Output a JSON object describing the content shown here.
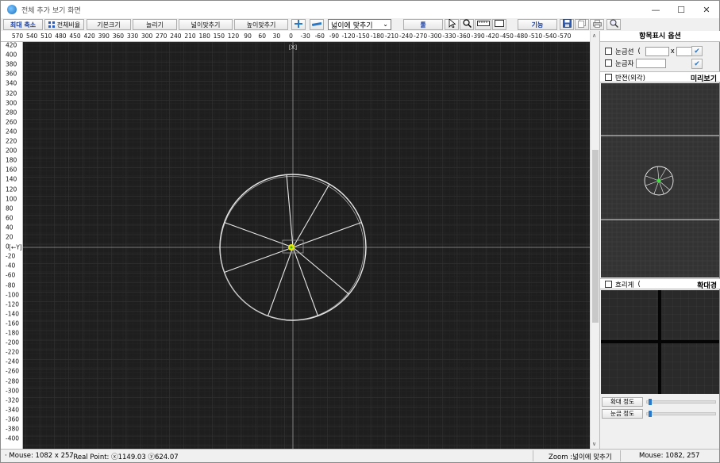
{
  "window": {
    "title": "전체 추가 보기 화면",
    "controls": {
      "minimize": "—",
      "maximize": "☐",
      "close": "✕"
    }
  },
  "toolbar": {
    "zoom_out_label": "최대 축소",
    "fit_all_label": "전체비율",
    "default_size_label": "기본크기",
    "enlarge_label": "늘리기",
    "fit_width_label": "넓이맞추기",
    "fit_height_label": "높이맞추기",
    "zoom_select_value": "넓이에 맞추기",
    "tools_label": "툴",
    "function_label": "기능"
  },
  "ruler": {
    "x_ticks": [
      "570",
      "540",
      "510",
      "480",
      "450",
      "420",
      "390",
      "360",
      "330",
      "300",
      "270",
      "240",
      "210",
      "180",
      "150",
      "120",
      "90",
      "60",
      "30",
      "0",
      "-30",
      "-60",
      "-90",
      "-120",
      "-150",
      "-180",
      "-210",
      "-240",
      "-270",
      "-300",
      "-330",
      "-360",
      "-390",
      "-420",
      "-450",
      "-480",
      "-510",
      "-540",
      "-570"
    ],
    "y_ticks": [
      "420",
      "400",
      "380",
      "360",
      "340",
      "320",
      "300",
      "280",
      "260",
      "240",
      "220",
      "200",
      "180",
      "160",
      "140",
      "120",
      "100",
      "80",
      "60",
      "40",
      "20",
      "0",
      "-20",
      "-40",
      "-60",
      "-80",
      "-100",
      "-120",
      "-140",
      "-160",
      "-180",
      "-200",
      "-220",
      "-240",
      "-260",
      "-280",
      "-300",
      "-320",
      "-340",
      "-360",
      "-380",
      "-400"
    ],
    "x_axis_label": "[X]",
    "y_axis_label": "[←Y]"
  },
  "drawing": {
    "circle_radius": 155,
    "spoke_angles_deg": [
      95,
      60,
      20,
      320,
      290,
      250,
      200,
      160
    ],
    "hub_color": "#e6e600",
    "line_color": "#e8e8e8"
  },
  "panel": {
    "title": "항목표시 옵션",
    "grid_lines_label": "눈금선",
    "grid_lines_paren": "(",
    "grid_lines_x": "x",
    "ruler_label": "눈금자",
    "ok_glyph": "✔",
    "invert_label": "반전(외각)",
    "preview_label": "미리보기",
    "blur_label": "흐리게",
    "blur_paren": "(",
    "magnifier_label": "확대경",
    "zoom_precision_label": "확대 정도",
    "grid_precision_label": "눈금 정도",
    "zoom_precision_value": 0.02,
    "grid_precision_value": 0.02
  },
  "status": {
    "mouse_text": "· Mouse: 1082 x 257",
    "real_point_text": "· Real Point: ⓧ1149.03 ⓨ624.07",
    "zoom_text": "Zoom :넓이에 맞추기",
    "mouse_right_text": "Mouse:  1082, 257"
  }
}
